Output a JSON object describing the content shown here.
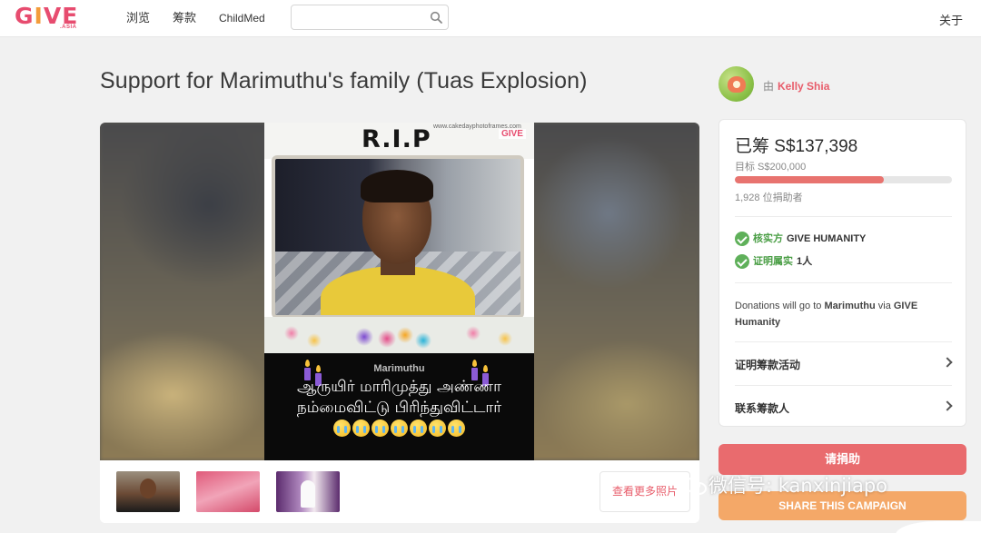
{
  "header": {
    "logo_text": "GIVE",
    "logo_sub": ".ASIA",
    "nav": [
      "浏览",
      "筹款",
      "ChildMed"
    ],
    "search_placeholder": "",
    "about_label": "关于"
  },
  "campaign": {
    "title": "Support for Marimuthu's family (Tuas Explosion)",
    "organizer_prefix": "由",
    "organizer_name": "Kelly Shia"
  },
  "poster": {
    "heading": "R.I.P",
    "credit": "www.cakedayphotoframes.com",
    "badge": "GIVE",
    "name": "Marimuthu",
    "line1": "ஆருயிர் மாரிமுத்து அண்ணா",
    "line2": "நம்மைவிட்டு பிரிந்துவிட்டார்",
    "emoji_count": 7
  },
  "gallery": {
    "thumbnail_count": 3,
    "more_photos_label": "查看更多照片"
  },
  "funding": {
    "raised_label": "已筹 S$137,398",
    "goal_label": "目标 S$200,000",
    "progress_fraction": 0.687,
    "donors_label": "1,928 位捐助者",
    "progress_color": "#e8736f"
  },
  "verification": [
    {
      "highlight": "核实方",
      "text": "GIVE HUMANITY"
    },
    {
      "highlight": "证明属实",
      "text": "1人"
    }
  ],
  "donation_note": {
    "prefix": "Donations will go to ",
    "recipient": "Marimuthu",
    "middle": " via ",
    "via": "GIVE Humanity"
  },
  "links": [
    {
      "label": "证明筹款活动"
    },
    {
      "label": "联系筹款人"
    }
  ],
  "actions": {
    "donate_label": "请捐助",
    "share_label": "SHARE THIS CAMPAIGN",
    "donate_color": "#e96b6e",
    "share_color": "#f4a868"
  },
  "watermark": {
    "text": "微信号: kanxinjiapo",
    "icon": "wechat-icon"
  }
}
